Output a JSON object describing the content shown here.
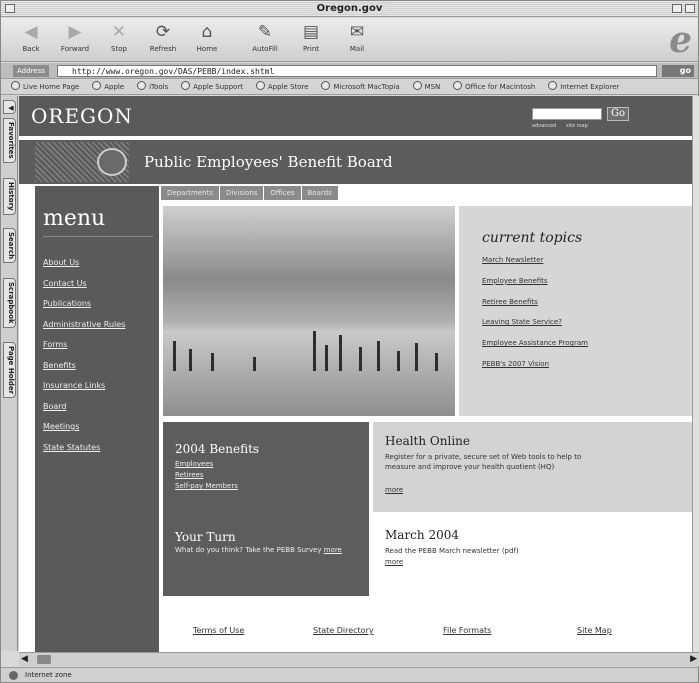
{
  "window": {
    "title": "Oregon.gov"
  },
  "toolbar": {
    "back": "Back",
    "forward": "Forward",
    "stop": "Stop",
    "refresh": "Refresh",
    "home": "Home",
    "autofill": "AutoFill",
    "print": "Print",
    "mail": "Mail"
  },
  "address": {
    "label": "Address",
    "url": "http://www.oregon.gov/DAS/PEBB/index.shtml",
    "go": "go"
  },
  "favorites": [
    "Live Home Page",
    "Apple",
    "iTools",
    "Apple Support",
    "Apple Store",
    "Microsoft MacTopia",
    "MSN",
    "Office for Macintosh",
    "Internet Explorer"
  ],
  "sidetabs": [
    "Favorites",
    "History",
    "Search",
    "Scrapbook",
    "Page Holder"
  ],
  "status": {
    "zone": "Internet zone"
  },
  "page": {
    "brand": "OREGON",
    "search_go": "Go",
    "search_links": [
      "advanced",
      "site map"
    ],
    "board_title": "Public Employees' Benefit Board",
    "nav": [
      "Departments",
      "Divisions",
      "Offices",
      "Boards"
    ],
    "menu_heading": "menu",
    "menu": [
      "About Us",
      "Contact Us",
      "Publications",
      "Administrative Rules",
      "Forms",
      "Benefits",
      "Insurance Links",
      "Board",
      "Meetings",
      "State Statutes"
    ],
    "topics_heading": "current topics",
    "topics": [
      "March Newsletter",
      "Employee Benefits",
      "Retiree Benefits",
      "Leaving State Service?",
      "Employee Assistance Program",
      "PEBB's 2007 Vision"
    ],
    "benefits_heading": "2004 Benefits",
    "benefits_links": [
      "Employees",
      "Retirees",
      "Self-pay Members"
    ],
    "yourturn_heading": "Your Turn",
    "yourturn_text": "What do you think? Take the PEBB Survey",
    "yourturn_more": "more",
    "health_heading": "Health Online",
    "health_text": "Register for a private, secure set of Web tools to help to measure and improve your health quotient (HQ)",
    "health_more": "more",
    "march_heading": "March 2004",
    "march_text": "Read the PEBB March newsletter (pdf)",
    "march_more": "more",
    "footer": [
      "Terms of Use",
      "State Directory",
      "File Formats",
      "Site Map"
    ]
  }
}
